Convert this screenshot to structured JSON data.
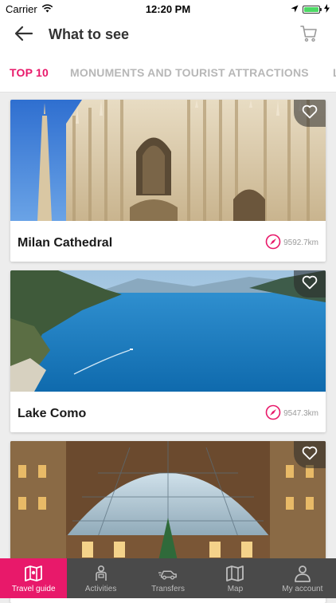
{
  "status_bar": {
    "carrier": "Carrier",
    "time": "12:20 PM",
    "wifi_icon": "wifi-icon",
    "location_icon": "location-arrow-icon",
    "battery_icon": "battery-icon",
    "charging_icon": "charging-bolt-icon",
    "battery_level": 1.0
  },
  "header": {
    "title": "What to see",
    "back_icon": "arrow-left-icon",
    "cart_icon": "cart-icon"
  },
  "tabs": [
    {
      "label": "TOP 10",
      "active": true
    },
    {
      "label": "MONUMENTS AND TOURIST ATTRACTIONS",
      "active": false
    },
    {
      "label": "L",
      "active": false
    }
  ],
  "places": [
    {
      "name": "Milan Cathedral",
      "distance": "9592.7km",
      "image": "milan-cathedral-photo",
      "favorite_icon": "heart-outline-icon",
      "distance_icon": "compass-icon"
    },
    {
      "name": "Lake Como",
      "distance": "9547.3km",
      "image": "lake-como-photo",
      "favorite_icon": "heart-outline-icon",
      "distance_icon": "compass-icon"
    },
    {
      "name": "",
      "distance": "",
      "image": "galleria-vittorio-emanuele-photo",
      "favorite_icon": "heart-outline-icon",
      "distance_icon": "compass-icon"
    }
  ],
  "bottom_nav": [
    {
      "label": "Travel guide",
      "icon": "map-book-icon",
      "active": true
    },
    {
      "label": "Activities",
      "icon": "tourist-person-icon",
      "active": false
    },
    {
      "label": "Transfers",
      "icon": "car-icon",
      "active": false
    },
    {
      "label": "Map",
      "icon": "map-icon",
      "active": false
    },
    {
      "label": "My account",
      "icon": "user-icon",
      "active": false
    }
  ],
  "colors": {
    "accent": "#e8196a",
    "nav_background": "#4a4a4a",
    "inactive_tab": "#b7b7b7"
  }
}
